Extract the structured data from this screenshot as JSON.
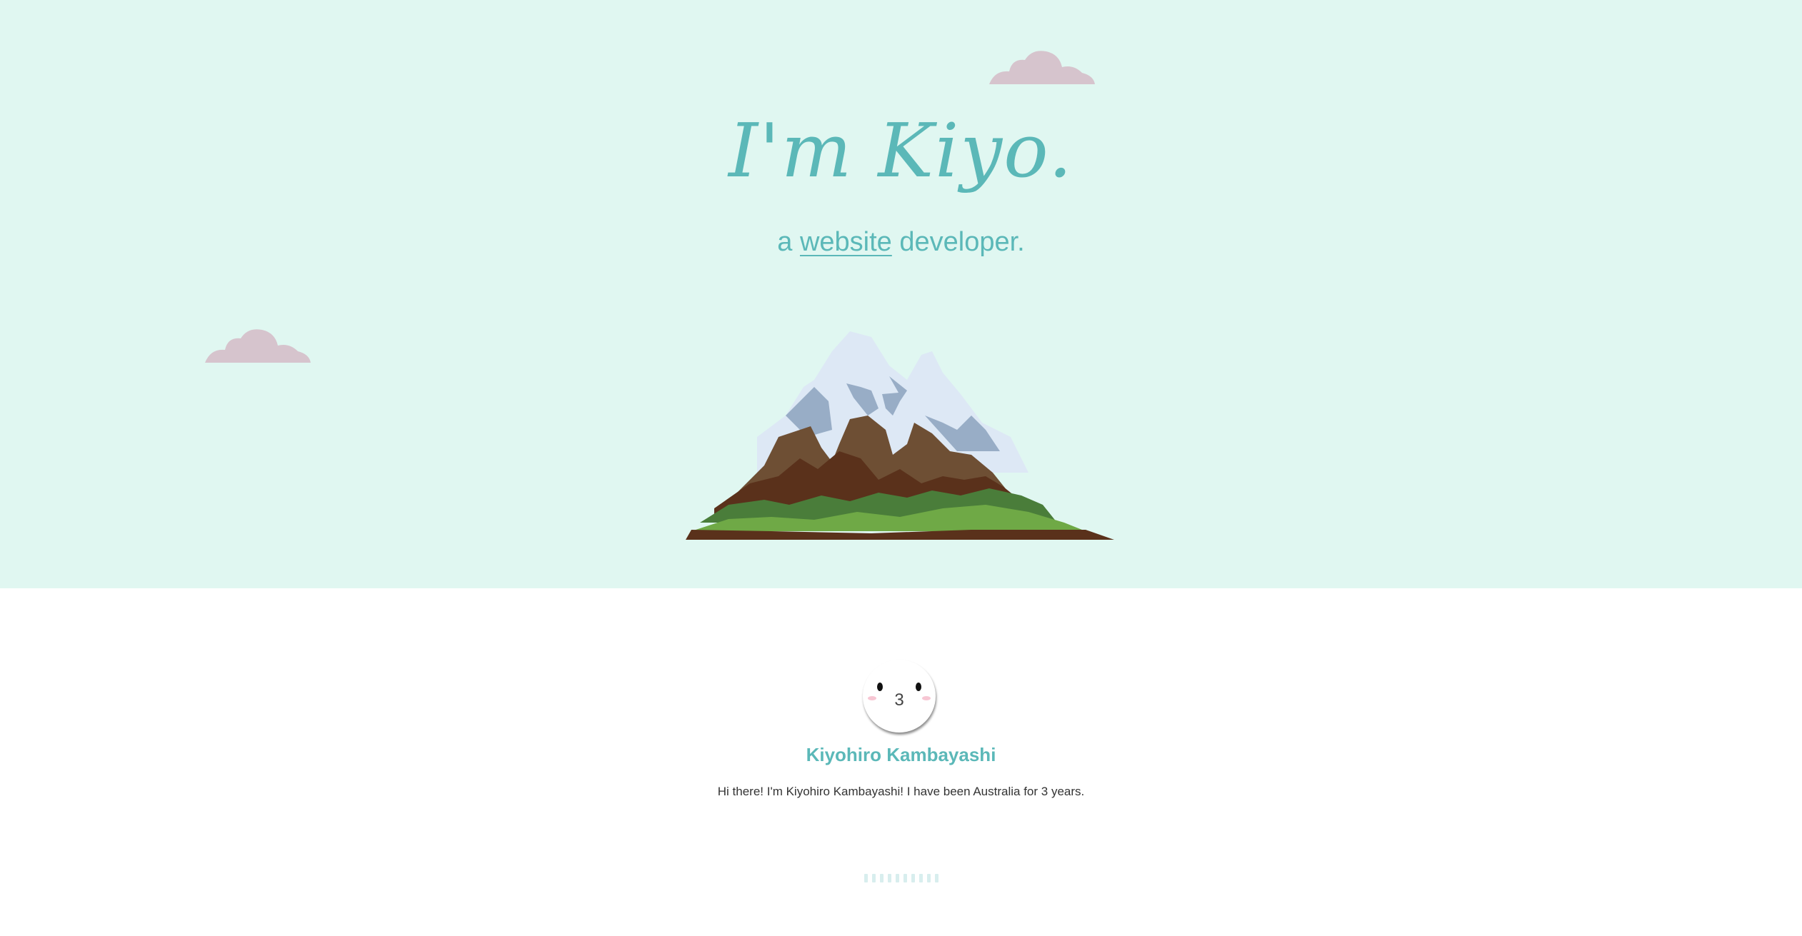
{
  "hero": {
    "title": "I'm Kiyo.",
    "subtitle_prefix": "a ",
    "subtitle_link": "website",
    "subtitle_suffix": " developer."
  },
  "profile": {
    "name": "Kiyohiro Kambayashi",
    "bio": "Hi there! I'm Kiyohiro Kambayashi! I have been Australia for 3 years.",
    "avatar_mouth": "3"
  },
  "colors": {
    "hero_bg": "#e0f7f1",
    "accent": "#5bb8b8",
    "cloud": "#d6c4cd"
  }
}
